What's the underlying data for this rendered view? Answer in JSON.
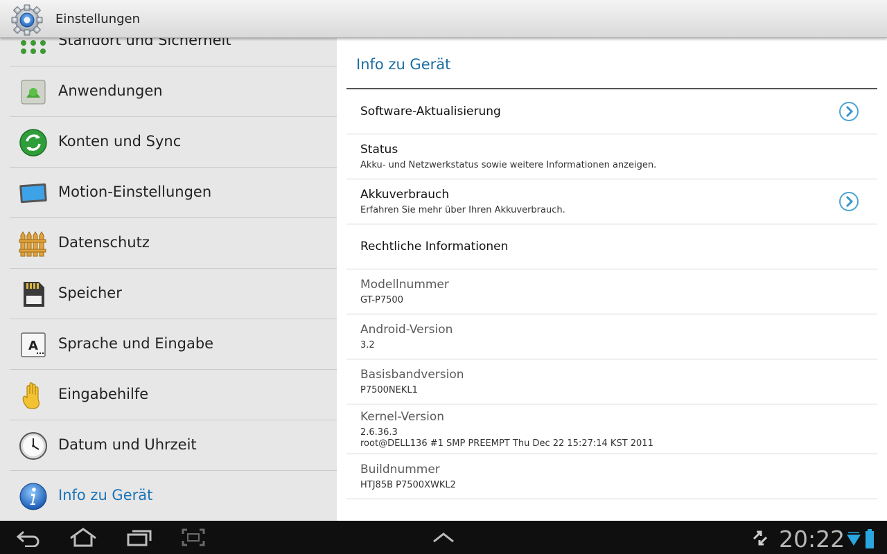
{
  "titlebar": {
    "title": "Einstellungen",
    "icon": "settings-gear-icon"
  },
  "nav": {
    "items": [
      {
        "label": "Standort und Sicherheit",
        "icon": "location-security-icon"
      },
      {
        "label": "Anwendungen",
        "icon": "applications-icon"
      },
      {
        "label": "Konten und Sync",
        "icon": "sync-icon"
      },
      {
        "label": "Motion-Einstellungen",
        "icon": "motion-icon"
      },
      {
        "label": "Datenschutz",
        "icon": "privacy-fence-icon"
      },
      {
        "label": "Speicher",
        "icon": "storage-sd-icon"
      },
      {
        "label": "Sprache und Eingabe",
        "icon": "language-input-icon"
      },
      {
        "label": "Eingabehilfe",
        "icon": "accessibility-hand-icon"
      },
      {
        "label": "Datum und Uhrzeit",
        "icon": "clock-icon"
      },
      {
        "label": "Info zu Gerät",
        "icon": "info-icon",
        "active": true
      }
    ]
  },
  "detail": {
    "title": "Info zu Gerät",
    "rows": [
      {
        "title": "Software-Aktualisierung",
        "subtitle": "",
        "chevron": true
      },
      {
        "title": "Status",
        "subtitle": "Akku- und Netzwerkstatus sowie weitere Informationen anzeigen.",
        "chevron": false
      },
      {
        "title": "Akkuverbrauch",
        "subtitle": "Erfahren Sie mehr über Ihren Akkuverbrauch.",
        "chevron": true
      },
      {
        "title": "Rechtliche Informationen",
        "subtitle": "",
        "chevron": false
      },
      {
        "title": "Modellnummer",
        "subtitle": "GT-P7500"
      },
      {
        "title": "Android-Version",
        "subtitle": "3.2"
      },
      {
        "title": "Basisbandversion",
        "subtitle": "P7500NEKL1"
      },
      {
        "title": "Kernel-Version",
        "subtitle": "2.6.36.3",
        "subtitle2": "root@DELL136 #1 SMP PREEMPT Thu Dec 22 15:27:14 KST 2011"
      },
      {
        "title": "Buildnummer",
        "subtitle": "HTJ85B P7500XWKL2"
      }
    ]
  },
  "sysbar": {
    "time": "20:22",
    "icons": [
      "back-icon",
      "home-icon",
      "recent-apps-icon",
      "screenshot-icon",
      "menu-up-icon",
      "sync-arrows-icon",
      "wifi-icon",
      "battery-icon"
    ]
  },
  "colors": {
    "accent": "#1a73b8",
    "title_accent": "#1a6ea0",
    "list_bg": "#e7e7e7",
    "sysbar_bg": "#0f0f0f"
  }
}
